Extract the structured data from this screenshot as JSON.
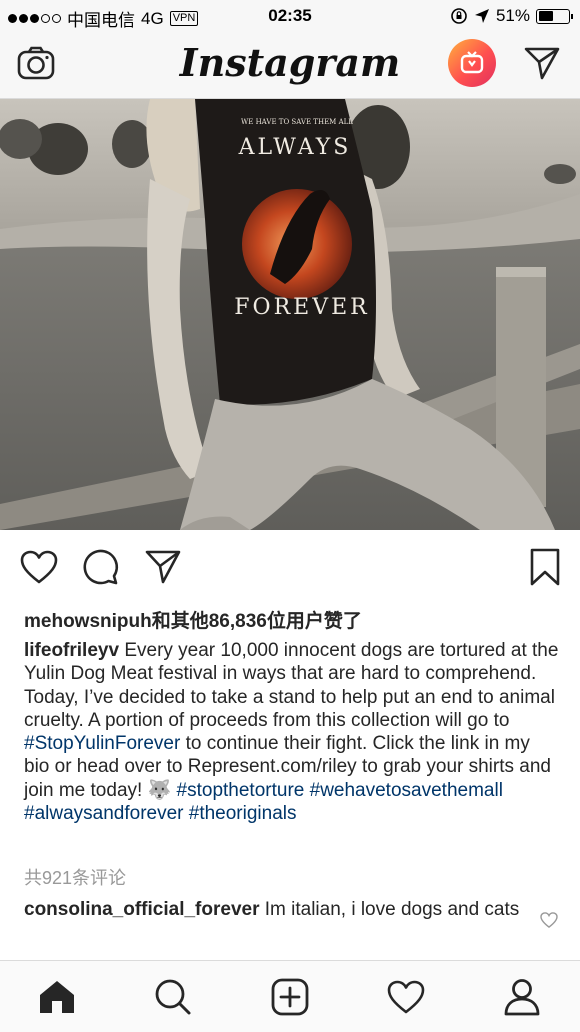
{
  "status_bar": {
    "carrier": "中国电信",
    "network": "4G",
    "vpn": "VPN",
    "time": "02:35",
    "battery": "51%",
    "battery_level": 0.51
  },
  "header": {
    "logo_text": "Instagram",
    "camera_icon": "camera-icon",
    "igtv_icon": "igtv-icon",
    "direct_icon": "paper-plane-icon"
  },
  "post": {
    "photo": {
      "shirt_text_top": "WE HAVE TO SAVE THEM ALL",
      "shirt_text_always": "ALWAYS",
      "shirt_text_forever": "FOREVER"
    },
    "actions": [
      "heart-icon",
      "comment-icon",
      "share-icon",
      "bookmark-icon"
    ],
    "likes_text": "mehowsnipuh和其他86,836位用户赞了",
    "caption": {
      "username": "lifeofrileyv",
      "text_1": "Every year 10,000 innocent dogs are tortured at the Yulin Dog Meat festival in ways that are hard to comprehend. Today, I’ve decided to take a stand to help put an end to animal cruelty. A portion of proceeds from this collection will go to ",
      "tag_1": "#StopYulinForever",
      "text_2": " to continue their fight. Click the link in my bio or head over to Represent.com/riley to grab your shirts and join me today! ",
      "emoji": "🐺",
      "tags": [
        "#stopthetorture",
        "#wehavetosavethemall",
        "#alwaysandforever",
        "#theoriginals"
      ]
    },
    "comments_count": "共921条评论",
    "comment": {
      "username": "consolina_official_forever",
      "text": "Im italian, i love dogs and cats"
    }
  },
  "bottom_nav": [
    "home-icon",
    "search-icon",
    "add-post-icon",
    "activity-heart-icon",
    "profile-icon"
  ]
}
